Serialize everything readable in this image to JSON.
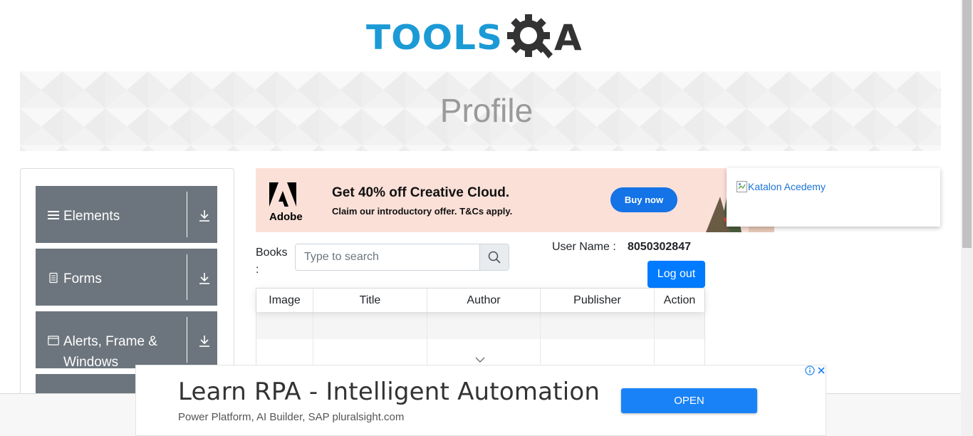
{
  "logo": {
    "text_tools": "TOOLS",
    "text_a": "A",
    "alt": "ToolsQA"
  },
  "banner": {
    "title": "Profile"
  },
  "sidebar": {
    "groups": [
      {
        "label": "Elements",
        "icon": "menu-icon"
      },
      {
        "label": "Forms",
        "icon": "document-icon"
      },
      {
        "label": "Alerts, Frame & Windows",
        "icon": "window-icon"
      }
    ]
  },
  "ads": {
    "adobe": {
      "brand": "Adobe",
      "headline": "Get 40% off Creative Cloud.",
      "subline": "Claim our introductory offer. T&Cs apply.",
      "button": "Buy now",
      "bg_color": "#fbe0d8",
      "button_color": "#1473e6"
    },
    "katalon": {
      "alt": "Katalon Acedemy"
    },
    "rpa": {
      "title": "Learn RPA - Intelligent Automation",
      "subtitle": "Power Platform, AI Builder, SAP pluralsight.com",
      "button": "OPEN",
      "button_color": "#1a82f7"
    }
  },
  "books": {
    "label": "Books :",
    "search_placeholder": "Type to search"
  },
  "user": {
    "label": "User Name :",
    "value": "8050302847",
    "logout": "Log out"
  },
  "table": {
    "columns": [
      "Image",
      "Title",
      "Author",
      "Publisher",
      "Action"
    ]
  },
  "colors": {
    "primary": "#007bff",
    "sidebar_group": "#6c757d",
    "logo_blue": "#1b9ad6",
    "logo_dark": "#333333"
  }
}
